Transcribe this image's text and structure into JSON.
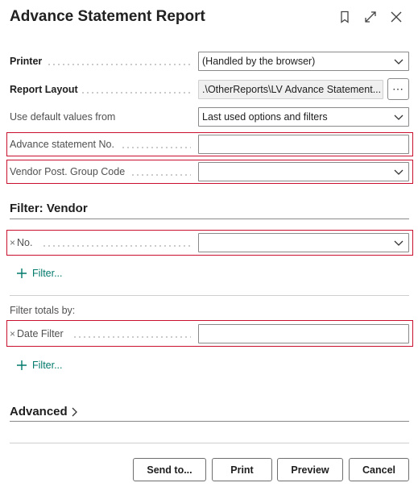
{
  "dialog": {
    "title": "Advance Statement Report"
  },
  "fields": {
    "printer": {
      "label": "Printer",
      "value": "(Handled by the browser)"
    },
    "report_layout": {
      "label": "Report Layout",
      "value": ".\\OtherReports\\LV Advance Statement...",
      "more": "⋯"
    },
    "use_default": {
      "label": "Use default values from",
      "value": "Last used options and filters"
    },
    "advance_no": {
      "label": "Advance statement No.",
      "value": ""
    },
    "vendor_post_group": {
      "label": "Vendor Post. Group Code",
      "value": ""
    }
  },
  "filter_vendor": {
    "heading": "Filter: Vendor",
    "no": {
      "remove": "×",
      "label": "No.",
      "value": ""
    },
    "add_filter": "Filter..."
  },
  "filter_totals": {
    "heading": "Filter totals by:",
    "date": {
      "remove": "×",
      "label": "Date Filter",
      "value": ""
    },
    "add_filter": "Filter..."
  },
  "advanced": {
    "label": "Advanced"
  },
  "buttons": {
    "send_to": "Send to...",
    "print": "Print",
    "preview": "Preview",
    "cancel": "Cancel"
  },
  "colors": {
    "accent": "#00796b",
    "highlight": "#c8102e"
  },
  "icons": [
    "bookmark-icon",
    "expand-icon",
    "close-icon",
    "chevron-down-icon",
    "plus-icon",
    "chevron-right-icon"
  ]
}
